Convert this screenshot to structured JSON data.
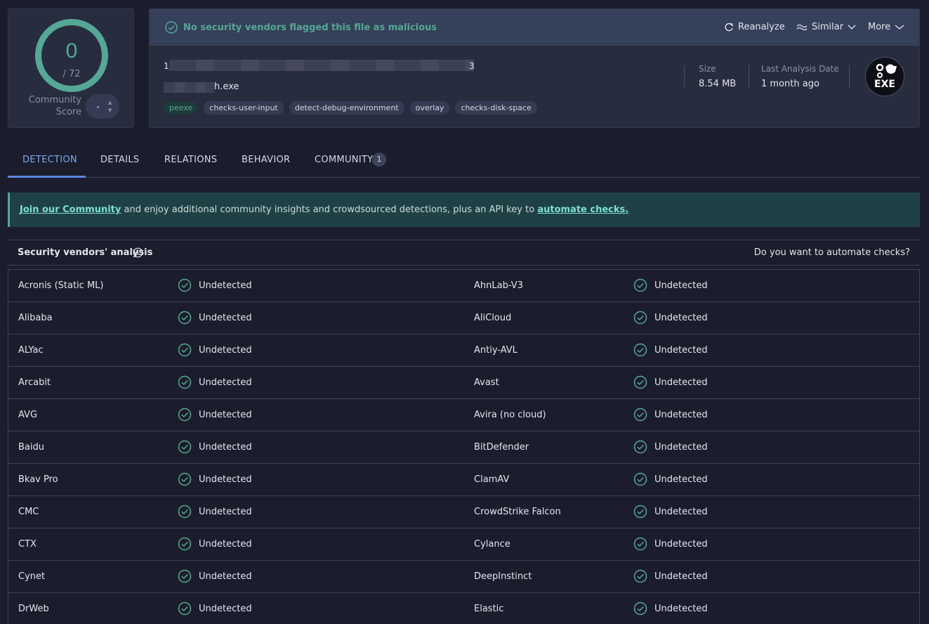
{
  "score": {
    "value": "0",
    "total": "/ 72",
    "community_label_line1": "Community",
    "community_label_line2": "Score"
  },
  "header": {
    "status_text": "No security vendors flagged this file as malicious",
    "reanalyze": "Reanalyze",
    "similar": "Similar",
    "more": "More",
    "hash_start": "1",
    "hash_end": "3",
    "filename_suffix": "h.exe",
    "tags": [
      "peexe",
      "checks-user-input",
      "detect-debug-environment",
      "overlay",
      "checks-disk-space"
    ],
    "size_label": "Size",
    "size_value": "8.54 MB",
    "date_label": "Last Analysis Date",
    "date_value": "1 month ago",
    "file_type": "EXE"
  },
  "tabs": [
    {
      "label": "DETECTION"
    },
    {
      "label": "DETAILS"
    },
    {
      "label": "RELATIONS"
    },
    {
      "label": "BEHAVIOR"
    },
    {
      "label": "COMMUNITY",
      "badge": "1"
    }
  ],
  "banner": {
    "link1": "Join our Community",
    "middle": " and enjoy additional community insights and crowdsourced detections, plus an API key to ",
    "link2": "automate checks."
  },
  "vendors_header": {
    "title": "Security vendors' analysis",
    "right": "Do you want to automate checks?"
  },
  "vendors": [
    {
      "left": "Acronis (Static ML)",
      "left_result": "Undetected",
      "right": "AhnLab-V3",
      "right_result": "Undetected"
    },
    {
      "left": "Alibaba",
      "left_result": "Undetected",
      "right": "AliCloud",
      "right_result": "Undetected"
    },
    {
      "left": "ALYac",
      "left_result": "Undetected",
      "right": "Antiy-AVL",
      "right_result": "Undetected"
    },
    {
      "left": "Arcabit",
      "left_result": "Undetected",
      "right": "Avast",
      "right_result": "Undetected"
    },
    {
      "left": "AVG",
      "left_result": "Undetected",
      "right": "Avira (no cloud)",
      "right_result": "Undetected"
    },
    {
      "left": "Baidu",
      "left_result": "Undetected",
      "right": "BitDefender",
      "right_result": "Undetected"
    },
    {
      "left": "Bkav Pro",
      "left_result": "Undetected",
      "right": "ClamAV",
      "right_result": "Undetected"
    },
    {
      "left": "CMC",
      "left_result": "Undetected",
      "right": "CrowdStrike Falcon",
      "right_result": "Undetected"
    },
    {
      "left": "CTX",
      "left_result": "Undetected",
      "right": "Cylance",
      "right_result": "Undetected"
    },
    {
      "left": "Cynet",
      "left_result": "Undetected",
      "right": "DeepInstinct",
      "right_result": "Undetected"
    },
    {
      "left": "DrWeb",
      "left_result": "Undetected",
      "right": "Elastic",
      "right_result": "Undetected"
    }
  ],
  "colors": {
    "accent_green": "#55a895",
    "link_blue": "#7ea7ea",
    "bg": "#1b1d2c"
  }
}
